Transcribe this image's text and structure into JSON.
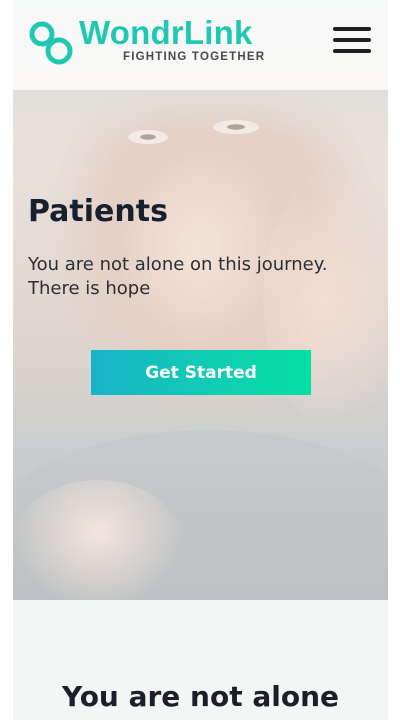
{
  "brand": {
    "name": "WondrLink",
    "tagline": "FIGHTING TOGETHER",
    "color": "#1ec9b0"
  },
  "header": {
    "menu_icon": "hamburger-menu-icon"
  },
  "hero": {
    "title": "Patients",
    "subtitle_line1": "You are not alone on this journey.",
    "subtitle_line2": "There is hope",
    "cta_label": "Get Started",
    "cta_gradient": [
      "#18b4c9",
      "#03e0a4"
    ]
  },
  "section": {
    "title": "You are not alone"
  }
}
